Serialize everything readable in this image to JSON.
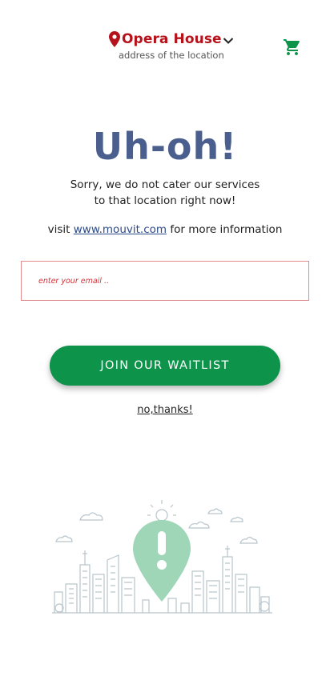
{
  "header": {
    "location_name": "Opera House",
    "location_sub": "address of the location",
    "icons": {
      "location": "map-pin-icon",
      "dropdown": "chevron-down-icon",
      "cart": "shopping-cart-icon"
    },
    "colors": {
      "location": "#b5121b",
      "cart": "#0e934b"
    }
  },
  "main": {
    "title": "Uh-oh!",
    "message_line1": "Sorry, we do not cater our services",
    "message_line2": "to that location right now!",
    "visit_prefix": "visit",
    "visit_link": "www.mouvit.com",
    "visit_suffix": "for more information",
    "email_placeholder": "enter your email ..",
    "join_button": "JOIN OUR WAITLIST",
    "no_thanks": "no,thanks!"
  },
  "illustration": {
    "name": "city-skyline-with-alert-pin",
    "pin_color": "#9fd6b8",
    "line_color": "#b9c5cc"
  },
  "colors": {
    "title": "#4a5f8d",
    "primary_button": "#0e934b",
    "input_border": "#e28a8a"
  }
}
